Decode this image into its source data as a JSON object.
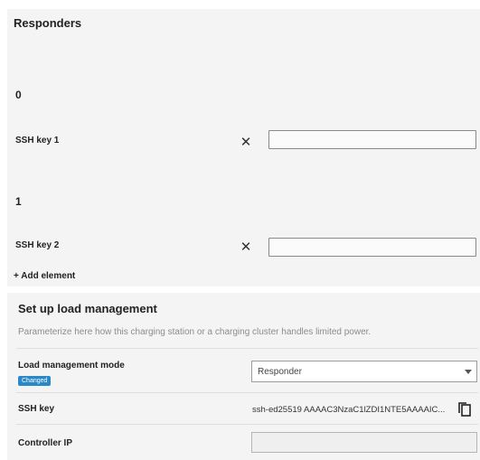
{
  "responders": {
    "title": "Responders",
    "items": [
      {
        "index": "0",
        "label": "SSH key 1",
        "value": ""
      },
      {
        "index": "1",
        "label": "SSH key 2",
        "value": ""
      }
    ],
    "remove_symbol": "✕",
    "add_label": "+ Add element"
  },
  "load_management": {
    "title": "Set up load management",
    "description": "Parameterize here how this charging station or a charging cluster handles limited power.",
    "mode_label": "Load management mode",
    "changed_badge": "Changed",
    "mode_value": "Responder",
    "ssh_key_label": "SSH key",
    "ssh_key_value": "ssh-ed25519 AAAAC3NzaC1lZDI1NTE5AAAAIC...",
    "controller_ip_label": "Controller IP",
    "controller_ip_value": ""
  },
  "icons": {
    "remove": "close-icon",
    "copy": "copy-icon",
    "caret": "chevron-down-icon"
  },
  "colors": {
    "panel_bg": "#f4f4f4",
    "badge_bg": "#2b88c6",
    "description_text": "#8c8c8c"
  }
}
